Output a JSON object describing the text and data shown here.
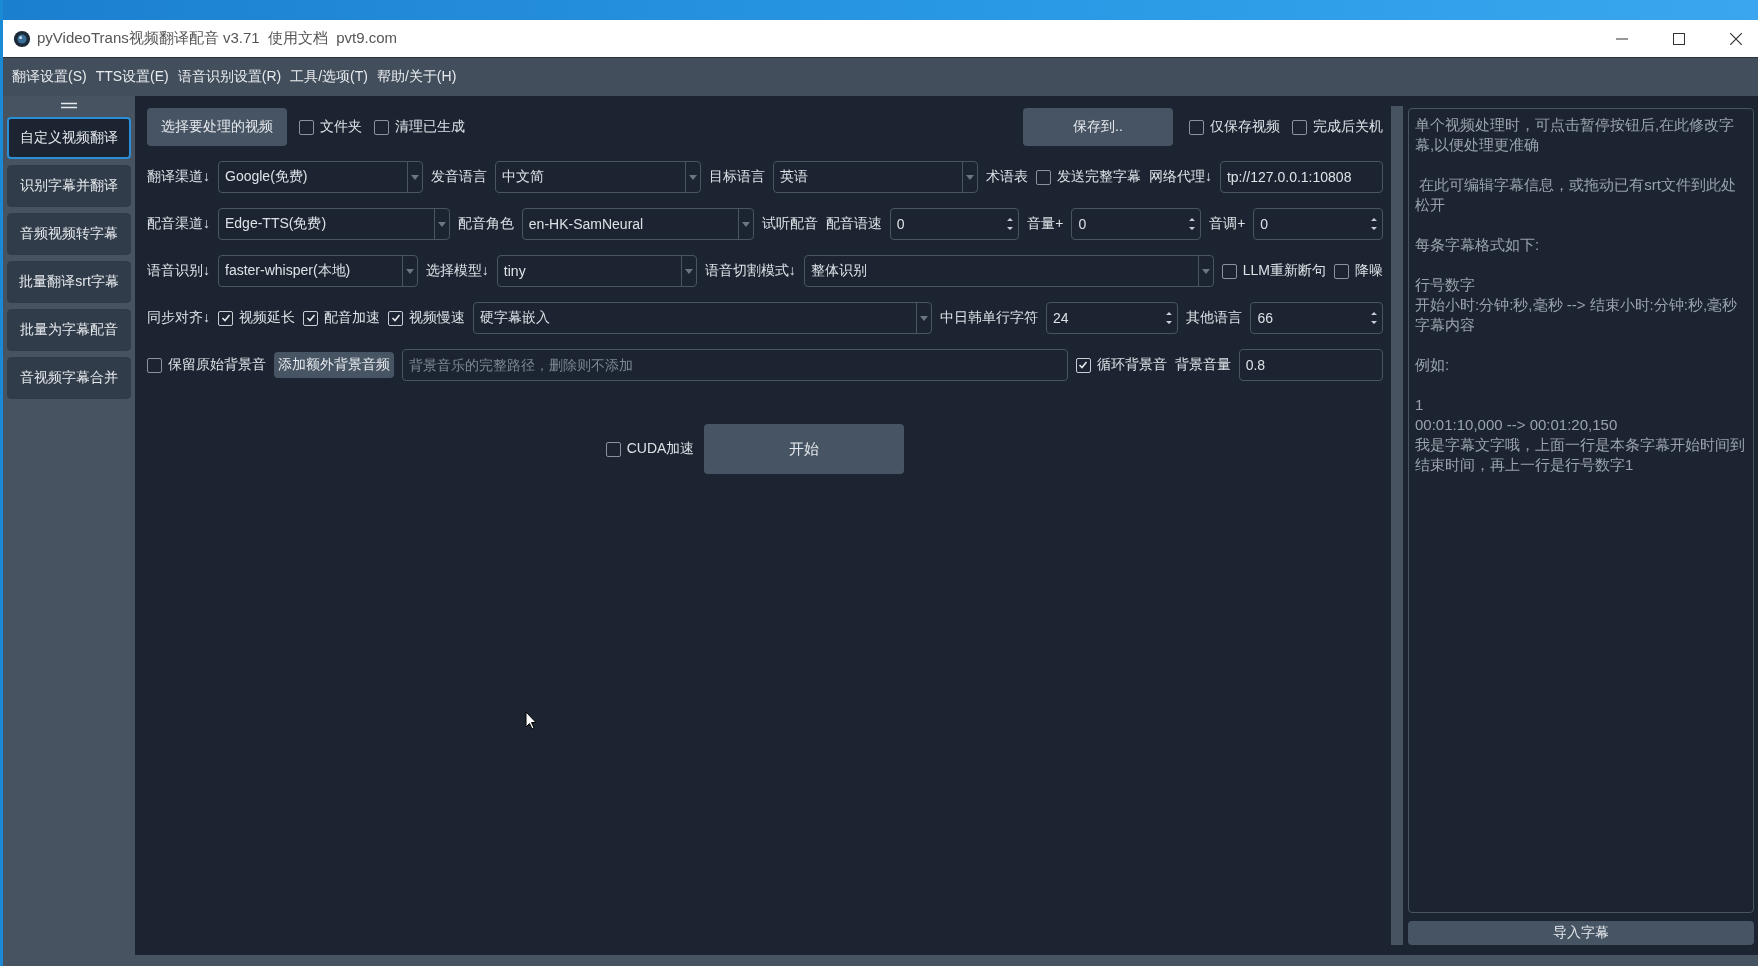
{
  "window": {
    "title": "pyVideoTrans视频翻译配音 v3.71  使用文档  pvt9.com"
  },
  "menu": [
    "翻译设置(S)",
    "TTS设置(E)",
    "语音识别设置(R)",
    "工具/选项(T)",
    "帮助/关于(H)"
  ],
  "sidebar": {
    "items": [
      {
        "label": "自定义视频翻译",
        "selected": true
      },
      {
        "label": "识别字幕并翻译",
        "selected": false
      },
      {
        "label": "音频视频转字幕",
        "selected": false
      },
      {
        "label": "批量翻译srt字幕",
        "selected": false
      },
      {
        "label": "批量为字幕配音",
        "selected": false
      },
      {
        "label": "音视频字幕合并",
        "selected": false
      }
    ]
  },
  "top_row": {
    "left": [
      {
        "kind": "button",
        "label": "选择要处理的视频"
      },
      {
        "kind": "checkbox",
        "label": "文件夹",
        "checked": false
      },
      {
        "kind": "checkbox",
        "label": "清理已生成",
        "checked": false
      }
    ],
    "right": [
      {
        "kind": "button",
        "label": "保存到.."
      },
      {
        "kind": "checkbox",
        "label": "仅保存视频",
        "checked": false
      },
      {
        "kind": "checkbox",
        "label": "完成后关机",
        "checked": false
      }
    ]
  },
  "rows": [
    {
      "items": [
        {
          "kind": "label",
          "text": "翻译渠道↓"
        },
        {
          "kind": "combo",
          "value": "Google(免费)"
        },
        {
          "kind": "label",
          "text": "发音语言"
        },
        {
          "kind": "combo",
          "value": "中文简"
        },
        {
          "kind": "label",
          "text": "目标语言"
        },
        {
          "kind": "combo",
          "value": "英语"
        },
        {
          "kind": "label",
          "text": "术语表"
        },
        {
          "kind": "checkbox",
          "label": "发送完整字幕",
          "checked": false
        },
        {
          "kind": "label",
          "text": "网络代理↓"
        },
        {
          "kind": "input",
          "value": "tp://127.0.0.1:10808"
        }
      ]
    },
    {
      "items": [
        {
          "kind": "label",
          "text": "配音渠道↓"
        },
        {
          "kind": "combo",
          "value": "Edge-TTS(免费)"
        },
        {
          "kind": "label",
          "text": "配音角色"
        },
        {
          "kind": "combo",
          "value": "en-HK-SamNeural"
        },
        {
          "kind": "label",
          "text": "试听配音"
        },
        {
          "kind": "label",
          "text": "配音语速"
        },
        {
          "kind": "spin",
          "value": "0"
        },
        {
          "kind": "label",
          "text": "音量+"
        },
        {
          "kind": "spin",
          "value": "0"
        },
        {
          "kind": "label",
          "text": "音调+"
        },
        {
          "kind": "spin",
          "value": "0"
        }
      ]
    },
    {
      "items": [
        {
          "kind": "label",
          "text": "语音识别↓"
        },
        {
          "kind": "combo",
          "value": "faster-whisper(本地)"
        },
        {
          "kind": "label",
          "text": "选择模型↓"
        },
        {
          "kind": "combo",
          "value": "tiny"
        },
        {
          "kind": "label",
          "text": "语音切割模式↓"
        },
        {
          "kind": "combo",
          "value": "整体识别"
        },
        {
          "kind": "checkbox",
          "label": "LLM重新断句",
          "checked": false
        },
        {
          "kind": "checkbox",
          "label": "降噪",
          "checked": false
        }
      ]
    },
    {
      "items": [
        {
          "kind": "label",
          "text": "同步对齐↓"
        },
        {
          "kind": "checkbox",
          "label": "视频延长",
          "checked": true
        },
        {
          "kind": "checkbox",
          "label": "配音加速",
          "checked": true
        },
        {
          "kind": "checkbox",
          "label": "视频慢速",
          "checked": true
        },
        {
          "kind": "combo",
          "value": "硬字幕嵌入"
        },
        {
          "kind": "label",
          "text": "中日韩单行字符"
        },
        {
          "kind": "spin",
          "value": "24"
        },
        {
          "kind": "label",
          "text": "其他语言"
        },
        {
          "kind": "spin",
          "value": "66"
        }
      ]
    },
    {
      "items": [
        {
          "kind": "checkbox",
          "label": "保留原始背景音",
          "checked": false
        },
        {
          "kind": "button",
          "label": "添加额外背景音频"
        },
        {
          "kind": "input",
          "placeholder": "背景音乐的完整路径，删除则不添加"
        },
        {
          "kind": "checkbox",
          "label": "循环背景音",
          "checked": true
        },
        {
          "kind": "label",
          "text": "背景音量"
        },
        {
          "kind": "input",
          "value": "0.8"
        }
      ]
    }
  ],
  "start_row": {
    "cuda": {
      "label": "CUDA加速",
      "checked": false
    },
    "start_button": "开始"
  },
  "subtitle_editor": {
    "paragraphs": [
      [
        "单个视频处理时，可点击暂停按钮后,在此修改字幕,以便处理更准确"
      ],
      [
        " 在此可编辑字幕信息，或拖动已有srt文件到此处松开"
      ],
      [
        "每条字幕格式如下:"
      ],
      [
        "行号数字",
        "开始小时:分钟:秒,毫秒 --> 结束小时:分钟:秒,毫秒",
        "字幕内容"
      ],
      [
        "例如:"
      ],
      [
        "1",
        "00:01:10,000 --> 00:01:20,150",
        "我是字幕文字哦，上面一行是本条字幕开始时间到结束时间，再上一行是行号数字1"
      ]
    ]
  },
  "import_button": "导入字幕"
}
